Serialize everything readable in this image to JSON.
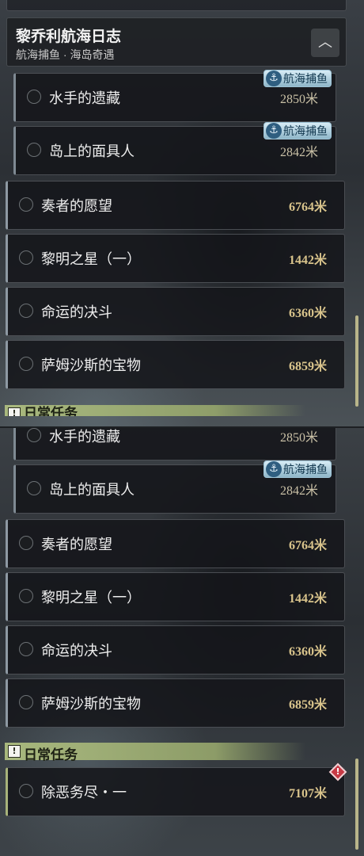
{
  "colors": {
    "distance": "#d9c48c",
    "daily_distance": "#d9c48c",
    "accent_tag": "#8fb6c9",
    "daily_bar": "#aebe80"
  },
  "journal": {
    "title": "黎乔利航海日志",
    "subtitle": "航海捕鱼 · 海岛奇遇",
    "collapse_icon": "chevron-up-icon"
  },
  "tag_label": "航海捕鱼",
  "top_view": {
    "sub_quests": [
      {
        "name": "水手的遗藏",
        "distance": "2850米",
        "tag": true
      },
      {
        "name": "岛上的面具人",
        "distance": "2842米",
        "tag": true
      }
    ],
    "main_quests": [
      {
        "name": "奏者的愿望",
        "distance": "6764米"
      },
      {
        "name": "黎明之星（一）",
        "distance": "1442米"
      },
      {
        "name": "命运的决斗",
        "distance": "6360米"
      },
      {
        "name": "萨姆沙斯的宝物",
        "distance": "6859米"
      }
    ],
    "daily_header_partial": "日常任务"
  },
  "bottom_view": {
    "sub_quests": [
      {
        "name": "水手的遗藏",
        "distance": "2850米"
      },
      {
        "name": "岛上的面具人",
        "distance": "2842米",
        "tag": true
      }
    ],
    "main_quests": [
      {
        "name": "奏者的愿望",
        "distance": "6764米"
      },
      {
        "name": "黎明之星（一）",
        "distance": "1442米"
      },
      {
        "name": "命运的决斗",
        "distance": "6360米"
      },
      {
        "name": "萨姆沙斯的宝物",
        "distance": "6859米"
      }
    ],
    "daily_header": "日常任务",
    "daily_icon": "!",
    "daily_quests": [
      {
        "name": "除恶务尽・一",
        "distance": "7107米",
        "alert": "!"
      }
    ]
  }
}
